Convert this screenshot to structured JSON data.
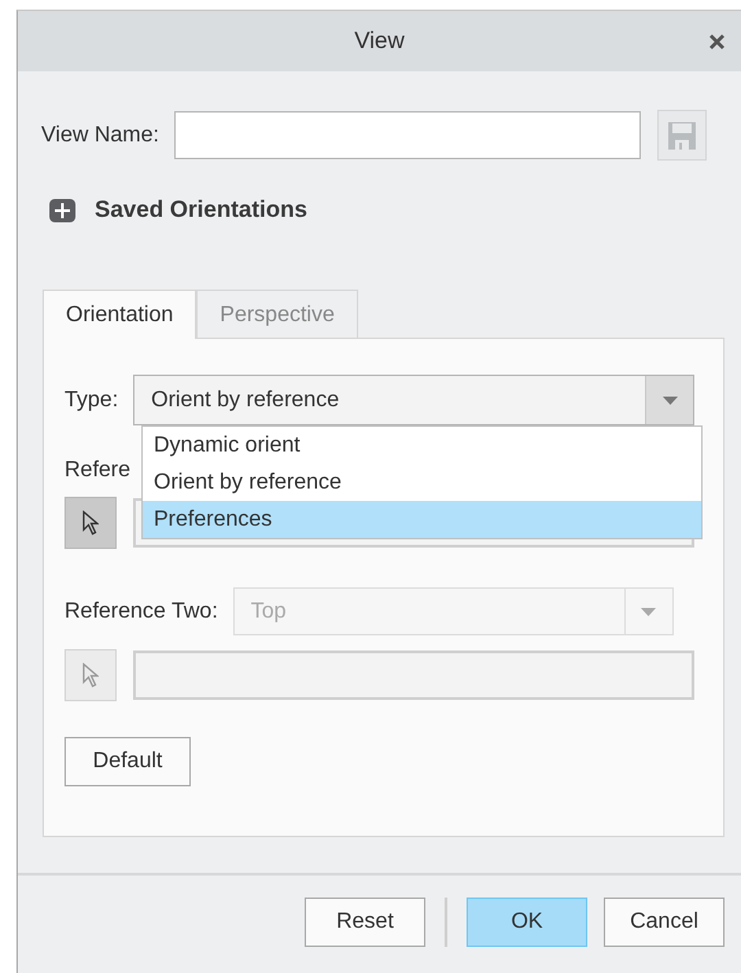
{
  "window": {
    "title": "View"
  },
  "view_name": {
    "label": "View Name:"
  },
  "saved_orientations": {
    "label": "Saved Orientations",
    "expanded": false
  },
  "tabs": [
    {
      "label": "Orientation",
      "selected": true
    },
    {
      "label": "Perspective",
      "selected": false
    }
  ],
  "type": {
    "label": "Type:",
    "value": "Orient by reference",
    "expanded": true,
    "options": [
      {
        "label": "Dynamic orient",
        "highlighted": false
      },
      {
        "label": "Orient by reference",
        "highlighted": false
      },
      {
        "label": "Preferences",
        "highlighted": true
      }
    ]
  },
  "reference_one": {
    "label": "Refere",
    "picker_active": true
  },
  "reference_two": {
    "label": "Reference Two:",
    "value": "Top",
    "disabled": true,
    "picker_active": false
  },
  "default_button": "Default",
  "buttons": [
    {
      "label": "Reset",
      "primary": false
    },
    {
      "label": "OK",
      "primary": true
    },
    {
      "label": "Cancel",
      "primary": false
    }
  ]
}
